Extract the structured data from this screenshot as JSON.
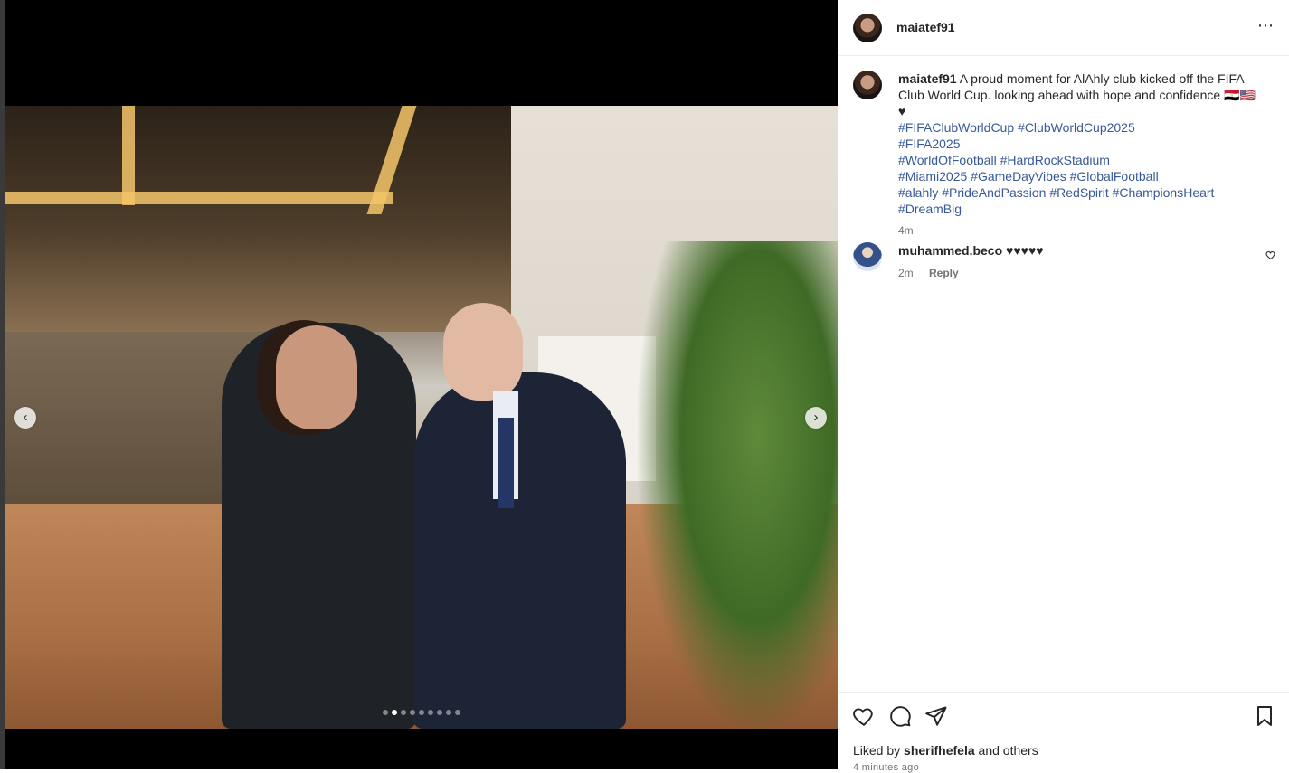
{
  "post": {
    "author": "maiatef91",
    "caption_user": "maiatef91",
    "caption_text": "A proud moment for AlAhly club kicked off the FIFA Club World Cup. looking ahead with hope and confidence 🇪🇬🇺🇸♥",
    "hashtags": [
      [
        "#FIFAClubWorldCup",
        "#ClubWorldCup2025"
      ],
      [
        "#FIFA2025"
      ],
      [
        "#WorldOfFootball",
        "#HardRockStadium"
      ],
      [
        "#Miami2025",
        "#GameDayVibes",
        "#GlobalFootball"
      ],
      [
        "#alahly",
        "#PrideAndPassion",
        "#RedSpirit",
        "#ChampionsHeart"
      ],
      [
        "#DreamBig"
      ]
    ],
    "caption_time": "4m",
    "more_icon": "⋯"
  },
  "comments": [
    {
      "user": "muhammed.beco",
      "text": "♥♥♥♥♥",
      "time": "2m",
      "reply_label": "Reply"
    }
  ],
  "carousel": {
    "total": 9,
    "active": 1,
    "prev_icon": "‹",
    "next_icon": "›"
  },
  "footer": {
    "liked_prefix": "Liked by",
    "liked_user": "sherifhefela",
    "liked_suffix": "and others",
    "timestamp": "4 minutes ago"
  },
  "colors": {
    "hashtag": "#385898",
    "muted": "#737373",
    "text": "#262626"
  }
}
